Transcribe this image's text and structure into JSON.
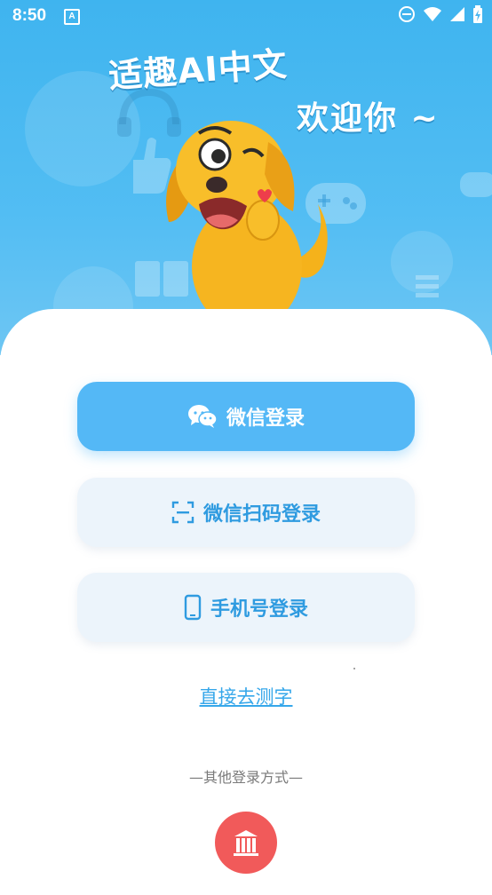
{
  "status_bar": {
    "time": "8:50",
    "notification_icon": "A"
  },
  "hero": {
    "title_line1": "适趣AI中文",
    "title_line2": "欢迎你 ~"
  },
  "login": {
    "wechat_label": "微信登录",
    "wechat_qr_label": "微信扫码登录",
    "phone_label": "手机号登录",
    "direct_link": "直接去测字",
    "other_methods": "—其他登录方式—"
  },
  "colors": {
    "primary": "#54b8f6",
    "secondary_bg": "#ecf4fb",
    "link": "#36a7ea",
    "alt_login": "#f15a5a"
  }
}
